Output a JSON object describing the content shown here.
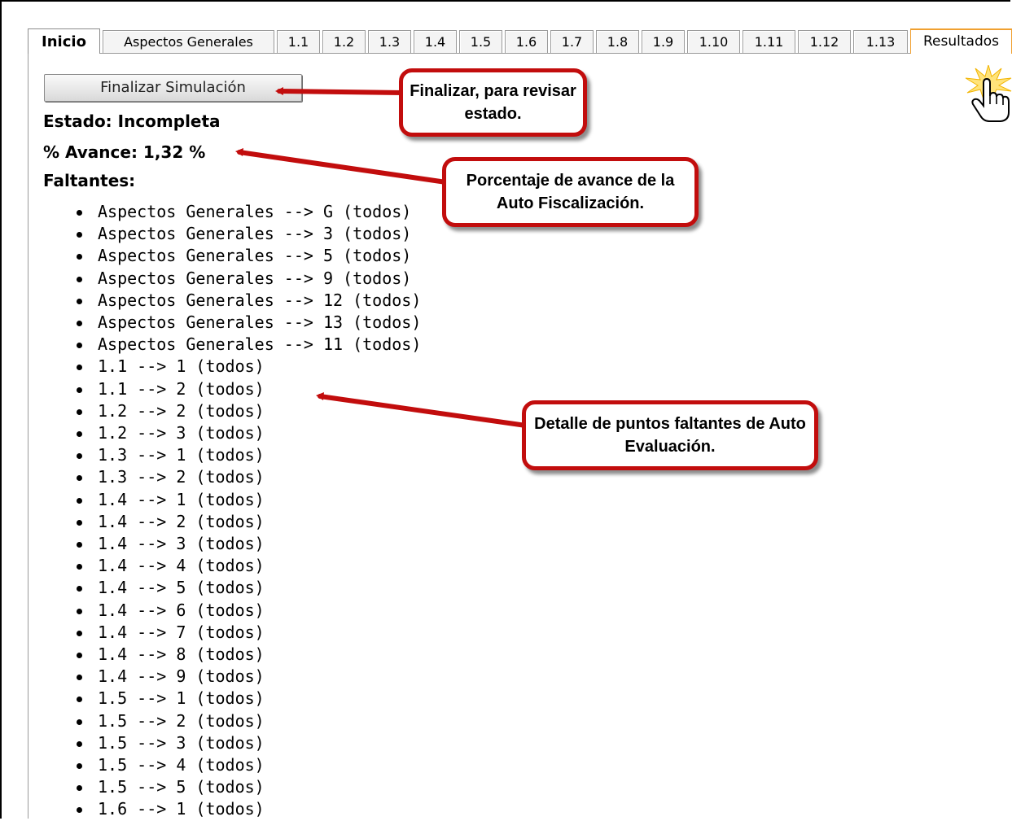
{
  "tabs": [
    {
      "label": "Inicio",
      "active": true
    },
    {
      "label": "Aspectos Generales"
    },
    {
      "label": "1.1"
    },
    {
      "label": "1.2"
    },
    {
      "label": "1.3"
    },
    {
      "label": "1.4"
    },
    {
      "label": "1.5"
    },
    {
      "label": "1.6"
    },
    {
      "label": "1.7"
    },
    {
      "label": "1.8"
    },
    {
      "label": "1.9"
    },
    {
      "label": "1.10"
    },
    {
      "label": "1.11"
    },
    {
      "label": "1.12"
    },
    {
      "label": "1.13"
    },
    {
      "label": "Resultados"
    }
  ],
  "finish_button": "Finalizar Simulación",
  "status": "Estado: Incompleta",
  "progress": "% Avance: 1,32 %",
  "missing_heading": "Faltantes:",
  "missing_items": [
    "Aspectos Generales --> G (todos)",
    "Aspectos Generales --> 3 (todos)",
    "Aspectos Generales --> 5 (todos)",
    "Aspectos Generales --> 9 (todos)",
    "Aspectos Generales --> 12 (todos)",
    "Aspectos Generales --> 13 (todos)",
    "Aspectos Generales --> 11 (todos)",
    "1.1 --> 1 (todos)",
    "1.1 --> 2 (todos)",
    "1.2 --> 2 (todos)",
    "1.2 --> 3 (todos)",
    "1.3 --> 1 (todos)",
    "1.3 --> 2 (todos)",
    "1.4 --> 1 (todos)",
    "1.4 --> 2 (todos)",
    "1.4 --> 3 (todos)",
    "1.4 --> 4 (todos)",
    "1.4 --> 5 (todos)",
    "1.4 --> 6 (todos)",
    "1.4 --> 7 (todos)",
    "1.4 --> 8 (todos)",
    "1.4 --> 9 (todos)",
    "1.5 --> 1 (todos)",
    "1.5 --> 2 (todos)",
    "1.5 --> 3 (todos)",
    "1.5 --> 4 (todos)",
    "1.5 --> 5 (todos)",
    "1.6 --> 1 (todos)"
  ],
  "callouts": {
    "finish": "Finalizar, para revisar estado.",
    "progress": "Porcentaje de avance de la Auto Fiscalización.",
    "detail": "Detalle de puntos faltantes de Auto Evaluación."
  },
  "colors": {
    "callout_border": "#c20d0d",
    "results_tab_accent": "#f0a030"
  },
  "icons": {
    "pointer": "hand-pointer-cursor-icon",
    "highlight": "click-burst-icon"
  }
}
